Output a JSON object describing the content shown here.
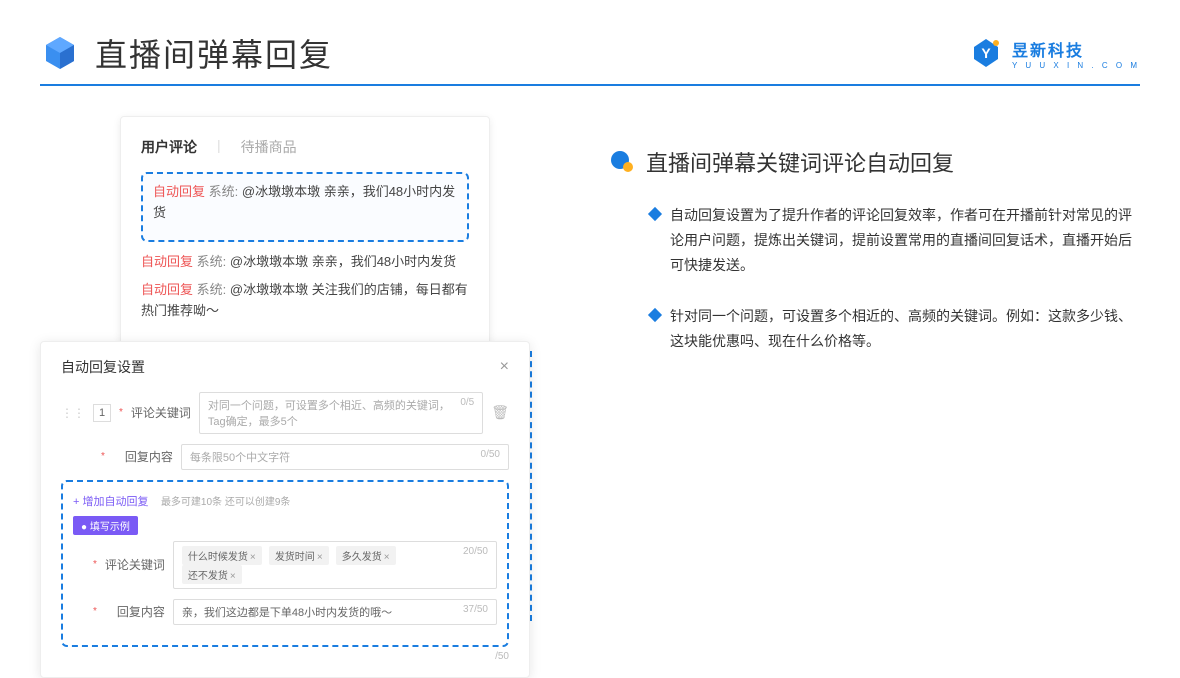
{
  "header": {
    "title": "直播间弹幕回复",
    "brand_cn": "昱新科技",
    "brand_en": "Y U U X I N . C O M"
  },
  "comments": {
    "tab_active": "用户评论",
    "tab_inactive": "待播商品",
    "auto_tag": "自动回复",
    "sys_label": "系统:",
    "msg1": "@冰墩墩本墩 亲亲，我们48小时内发货",
    "msg2": "@冰墩墩本墩 亲亲，我们48小时内发货",
    "msg3": "@冰墩墩本墩 关注我们的店铺，每日都有热门推荐呦～"
  },
  "settings": {
    "title": "自动回复设置",
    "close": "×",
    "row_num": "1",
    "keyword_label": "评论关键词",
    "keyword_placeholder": "对同一个问题，可设置多个相近、高频的关键词，Tag确定，最多5个",
    "keyword_count": "0/5",
    "content_label": "回复内容",
    "content_placeholder": "每条限50个中文字符",
    "content_count": "0/50",
    "add_link": "+ 增加自动回复",
    "add_hint": "最多可建10条 还可以创建9条",
    "example_badge": "● 填写示例",
    "ex_keyword_label": "评论关键词",
    "tags": [
      "什么时候发货",
      "发货时间",
      "多久发货",
      "还不发货"
    ],
    "ex_keyword_count": "20/50",
    "ex_content_label": "回复内容",
    "ex_content_value": "亲，我们这边都是下单48小时内发货的哦～",
    "ex_content_count": "37/50",
    "outer_count": "/50"
  },
  "right": {
    "section_title": "直播间弹幕关键词评论自动回复",
    "bullet1": "自动回复设置为了提升作者的评论回复效率，作者可在开播前针对常见的评论用户问题，提炼出关键词，提前设置常用的直播间回复话术，直播开始后可快捷发送。",
    "bullet2": "针对同一个问题，可设置多个相近的、高频的关键词。例如：这款多少钱、这块能优惠吗、现在什么价格等。"
  }
}
